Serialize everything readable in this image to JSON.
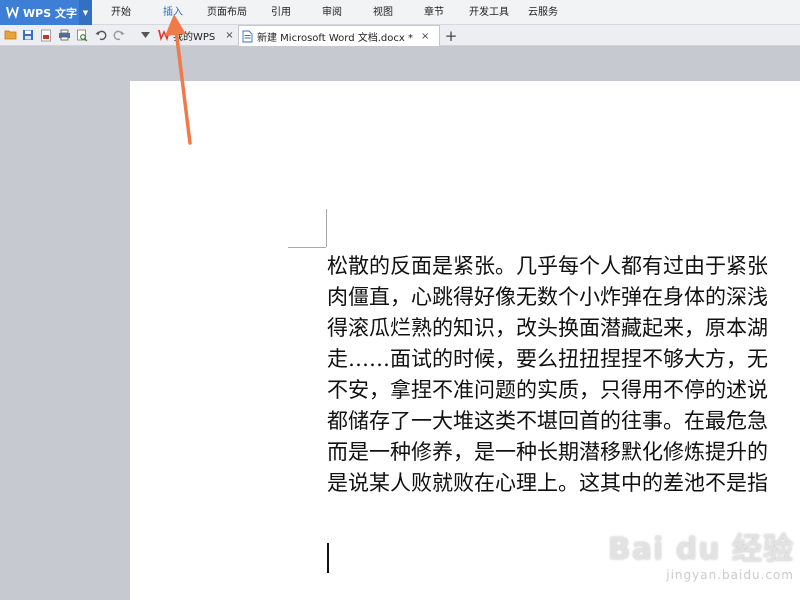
{
  "app": {
    "name": "WPS 文字",
    "accent_color": "#3d7fd6"
  },
  "menu": {
    "items": [
      {
        "label": "开始"
      },
      {
        "label": "插入"
      },
      {
        "label": "页面布局"
      },
      {
        "label": "引用"
      },
      {
        "label": "审阅"
      },
      {
        "label": "视图"
      },
      {
        "label": "章节"
      },
      {
        "label": "开发工具"
      },
      {
        "label": "云服务"
      }
    ],
    "active": "插入"
  },
  "toolbar": {
    "icons": [
      "open-folder-icon",
      "save-icon",
      "export-icon",
      "print-icon",
      "print-preview-icon",
      "undo-icon",
      "redo-icon",
      "dropdown-arrow-icon"
    ]
  },
  "tabs": [
    {
      "label": "我的WPS",
      "close": "×"
    },
    {
      "label": "新建 Microsoft Word 文档.docx *",
      "close": "×"
    }
  ],
  "new_tab": "+",
  "document": {
    "lines": [
      "松散的反面是紧张。几乎每个人都有过由于紧张",
      "肉僵直，心跳得好像无数个小炸弹在身体的深浅",
      "得滚瓜烂熟的知识，改头换面潜藏起来，原本湖",
      "走……面试的时候，要么扭扭捏捏不够大方，无",
      "不安，拿捏不准问题的实质，只得用不停的述说",
      "都储存了一大堆这类不堪回首的往事。在最危急",
      "而是一种修养，是一种长期潜移默化修炼提升的",
      "是说某人败就败在心理上。这其中的差池不是指"
    ]
  },
  "watermark": {
    "main": "Bai du 经验",
    "sub": "jingyan.baidu.com"
  }
}
